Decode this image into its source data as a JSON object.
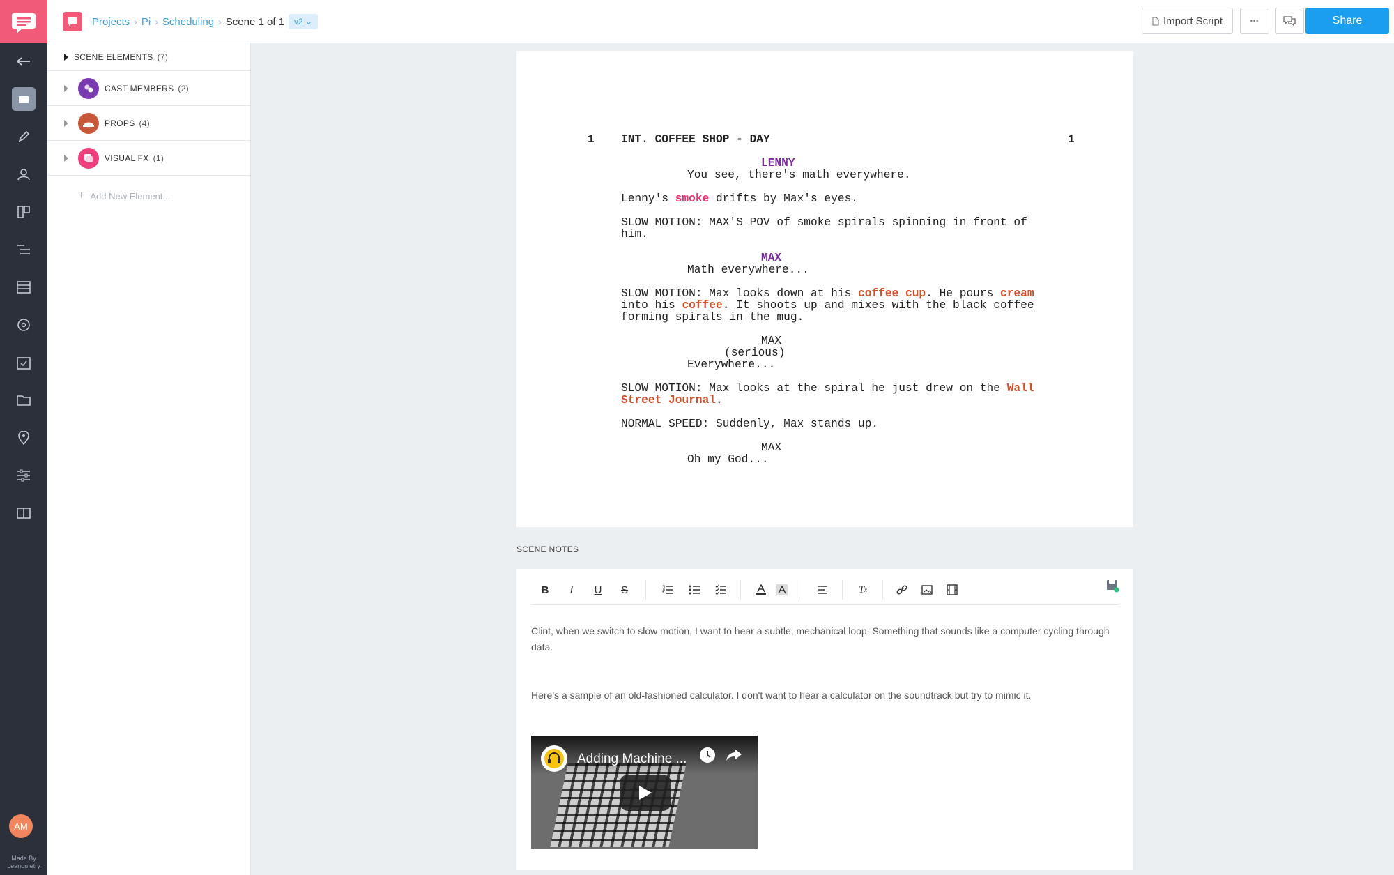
{
  "app": {
    "made_by_label": "Made By",
    "made_by_name": "Leanometry",
    "avatar_initials": "AM",
    "accent_color": "#f25a79",
    "share_color": "#1b9df0"
  },
  "breadcrumb": {
    "items": [
      "Projects",
      "Pi",
      "Scheduling"
    ],
    "current": "Scene 1 of 1",
    "version": "v2"
  },
  "toolbar": {
    "import_label": "Import Script",
    "more_label": "•••",
    "share_label": "Share"
  },
  "elements_panel": {
    "header": "SCENE ELEMENTS",
    "header_count": "(7)",
    "categories": [
      {
        "label": "CAST MEMBERS",
        "count": "(2)",
        "color": "#7b3bb0",
        "icon": "cast-icon"
      },
      {
        "label": "PROPS",
        "count": "(4)",
        "color": "#c8583a",
        "icon": "props-icon"
      },
      {
        "label": "VISUAL FX",
        "count": "(1)",
        "color": "#f03d7e",
        "icon": "vfx-icon"
      }
    ],
    "add_label": "Add New Element..."
  },
  "script": {
    "scene_number": "1",
    "heading": "INT. COFFEE SHOP - DAY",
    "lines": {
      "c1": "LENNY",
      "d1": "You see, there's math everywhere.",
      "a1_pre": "Lenny's ",
      "a1_hl": "smoke",
      "a1_post": " drifts by Max's eyes.",
      "a2_l1": "SLOW MOTION: MAX'S POV of smoke spirals spinning in front of",
      "a2_l2": "him.",
      "c2": "MAX",
      "d2": "Math everywhere...",
      "a3_l1_pre": "SLOW MOTION: Max looks down at his ",
      "a3_l1_hl1": "coffee cup",
      "a3_l1_mid": ". He pours ",
      "a3_l1_hl2": "cream",
      "a3_l2_pre": "into his ",
      "a3_l2_hl": "coffee",
      "a3_l2_post": ". It shoots up and mixes with the black coffee",
      "a3_l3": "forming spirals in the mug.",
      "c3": "MAX",
      "p3": "(serious)",
      "d3": "Everywhere...",
      "a4_l1_pre": "SLOW MOTION: Max looks at the spiral he just drew on the ",
      "a4_l1_hl": "Wall",
      "a4_l2_hl": "Street Journal",
      "a4_l2_post": ".",
      "a5": "NORMAL SPEED: Suddenly, Max stands up.",
      "c4": "MAX",
      "d4": "Oh my God..."
    }
  },
  "notes": {
    "label": "SCENE NOTES",
    "para1": "Clint, when we switch to slow motion, I want to hear a subtle, mechanical loop. Something that sounds like a computer cycling through data.",
    "para2": "Here's a sample of an old-fashioned calculator. I don't want to hear a calculator on the soundtrack but try to mimic it.",
    "video_title": "Adding Machine ..."
  }
}
